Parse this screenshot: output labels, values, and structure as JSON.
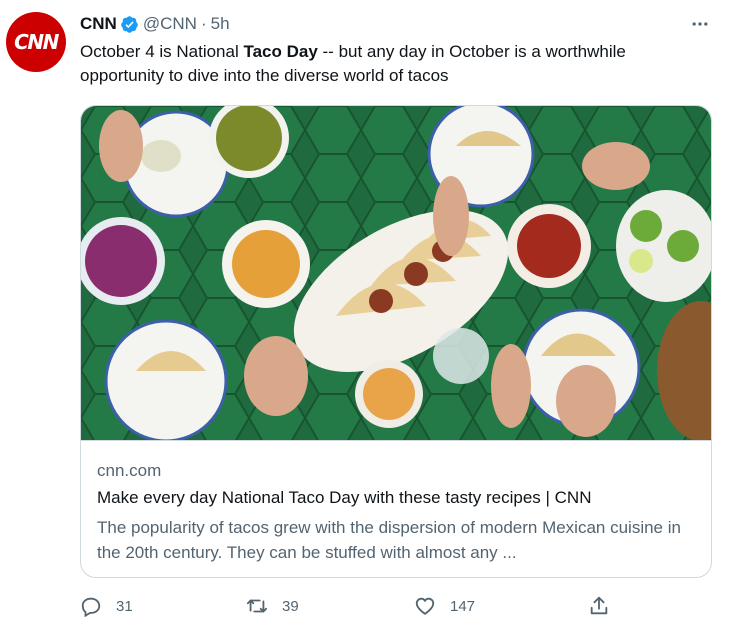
{
  "tweet": {
    "author_name": "CNN",
    "avatar_logo": "CNN",
    "handle": "@CNN",
    "separator": "·",
    "time": "5h",
    "text_before": "October 4 is National ",
    "text_bold": "Taco Day",
    "text_after": " -- but any day in October is a worthwhile opportunity to dive into the diverse world of tacos",
    "verified_color": "#1d9bf0",
    "brand_color": "#cc0000"
  },
  "card": {
    "domain": "cnn.com",
    "title": "Make every day National Taco Day with these tasty recipes | CNN",
    "description": "The popularity of tacos grew with the dispersion of modern Mexican cuisine in the 20th century. They can be stuffed with almost any ...",
    "image_icon": "photo-tacos-on-green-tiled-table"
  },
  "actions": {
    "reply_count": "31",
    "retweet_count": "39",
    "like_count": "147",
    "reply_icon": "reply-icon",
    "retweet_icon": "retweet-icon",
    "like_icon": "heart-icon",
    "share_icon": "share-icon"
  }
}
